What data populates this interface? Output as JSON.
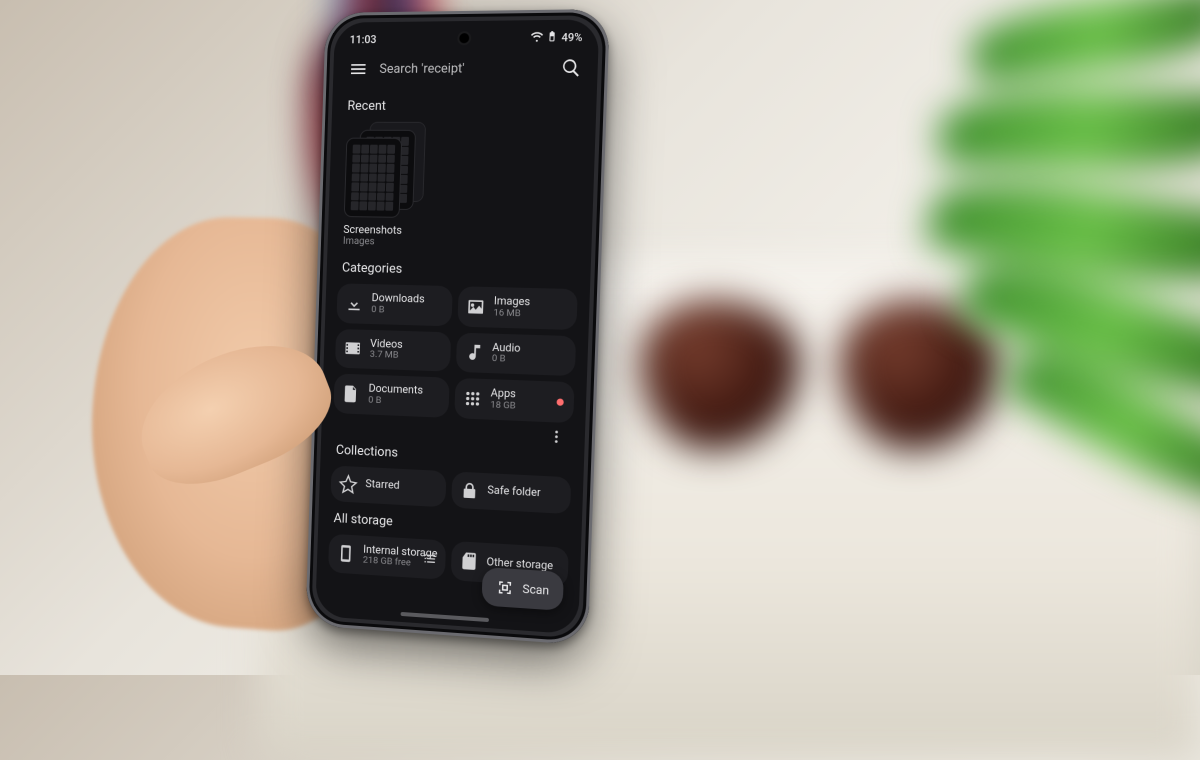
{
  "statusbar": {
    "time": "11:03",
    "battery_pct": "49%"
  },
  "search": {
    "placeholder": "Search 'receipt'"
  },
  "recent": {
    "title": "Recent",
    "item": {
      "title": "Screenshots",
      "subtitle": "Images"
    }
  },
  "categories": {
    "title": "Categories",
    "tiles": [
      {
        "icon": "download-icon",
        "title": "Downloads",
        "subtitle": "0 B",
        "notify": false
      },
      {
        "icon": "image-icon",
        "title": "Images",
        "subtitle": "16 MB",
        "notify": false
      },
      {
        "icon": "video-icon",
        "title": "Videos",
        "subtitle": "3.7 MB",
        "notify": false
      },
      {
        "icon": "audio-icon",
        "title": "Audio",
        "subtitle": "0 B",
        "notify": false
      },
      {
        "icon": "document-icon",
        "title": "Documents",
        "subtitle": "0 B",
        "notify": false
      },
      {
        "icon": "apps-icon",
        "title": "Apps",
        "subtitle": "18 GB",
        "notify": true
      }
    ]
  },
  "collections": {
    "title": "Collections",
    "tiles": [
      {
        "icon": "star-icon",
        "title": "Starred"
      },
      {
        "icon": "lock-icon",
        "title": "Safe folder"
      }
    ]
  },
  "storage": {
    "title": "All storage",
    "tiles": [
      {
        "icon": "phone-icon",
        "title": "Internal storage",
        "subtitle": "218 GB free"
      },
      {
        "icon": "sd-icon",
        "title": "Other storage",
        "subtitle": ""
      }
    ]
  },
  "fab": {
    "label": "Scan"
  }
}
